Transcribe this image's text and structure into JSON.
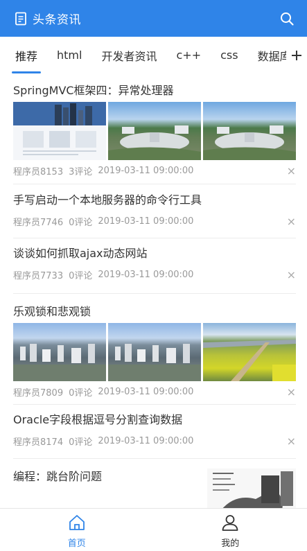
{
  "header": {
    "title": "头条资讯",
    "doc_icon": "document-icon",
    "search_icon": "search-icon"
  },
  "tabs": [
    "推荐",
    "html",
    "开发者资讯",
    "c++",
    "css",
    "数据库"
  ],
  "active_tab": "推荐",
  "add_tab_icon": "plus-icon",
  "articles": [
    {
      "title": "SpringMVC框架四：异常处理器",
      "author": "程序员8153",
      "comments": "3评论",
      "time": "2019-03-11 09:00:00"
    },
    {
      "title": "手写启动一个本地服务器的命令行工具",
      "author": "程序员7746",
      "comments": "0评论",
      "time": "2019-03-11 09:00:00"
    },
    {
      "title": "谈谈如何抓取ajax动态网站",
      "author": "程序员7733",
      "comments": "0评论",
      "time": "2019-03-11 09:00:00"
    },
    {
      "title": "乐观锁和悲观锁",
      "author": "程序员7809",
      "comments": "0评论",
      "time": "2019-03-11 09:00:00"
    },
    {
      "title": "Oracle字段根据逗号分割查询数据",
      "author": "程序员8174",
      "comments": "0评论",
      "time": "2019-03-11 09:00:00"
    },
    {
      "title": "编程：跳台阶问题"
    }
  ],
  "close_icon": "×",
  "bottom_nav": [
    {
      "label": "首页",
      "icon": "home-icon"
    },
    {
      "label": "我的",
      "icon": "user-icon"
    }
  ],
  "colors": {
    "primary": "#2f84e8",
    "meta_text": "#999999"
  }
}
